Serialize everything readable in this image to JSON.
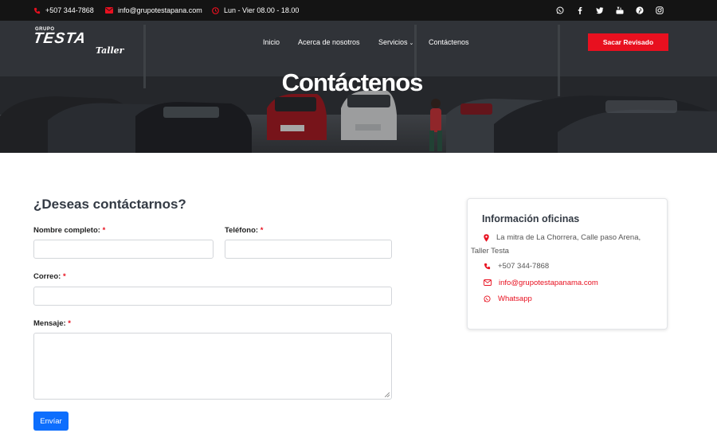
{
  "topbar": {
    "phone": "+507 344-7868",
    "email": "info@grupotestapana.com",
    "hours": "Lun - Vier 08.00 - 18.00",
    "socials": [
      "whatsapp-icon",
      "facebook-icon",
      "twitter-icon",
      "youtube-icon",
      "pinterest-icon",
      "instagram-icon"
    ]
  },
  "brand": {
    "grupo": "GRUPO",
    "testa": "TESTA",
    "taller": "Taller"
  },
  "nav": {
    "items": [
      "Inicio",
      "Acerca de nosotros",
      "Servicios",
      "Contáctenos"
    ],
    "dropdown_icon": "chevron-down-icon",
    "cta": "Sacar Revisado"
  },
  "hero": {
    "title": "Contáctenos"
  },
  "form": {
    "title": "¿Deseas contáctarnos?",
    "name_label": "Nombre completo:",
    "phone_label": "Teléfono:",
    "email_label": "Correo:",
    "message_label": "Mensaje:",
    "required_mark": "*",
    "name_value": "",
    "phone_value": "",
    "email_value": "",
    "message_value": "",
    "submit": "Envíar"
  },
  "info": {
    "title": "Información oficinas",
    "address_line1": "La mitra de La Chorrera, Calle paso Arena,",
    "address_line2": "Taller Testa",
    "phone": "+507 344-7868",
    "email": "info@grupotestapanama.com",
    "whatsapp": "Whatsapp"
  },
  "colors": {
    "accent": "#e8101f",
    "primary_button": "#0d6efd",
    "topbar": "#141414"
  }
}
